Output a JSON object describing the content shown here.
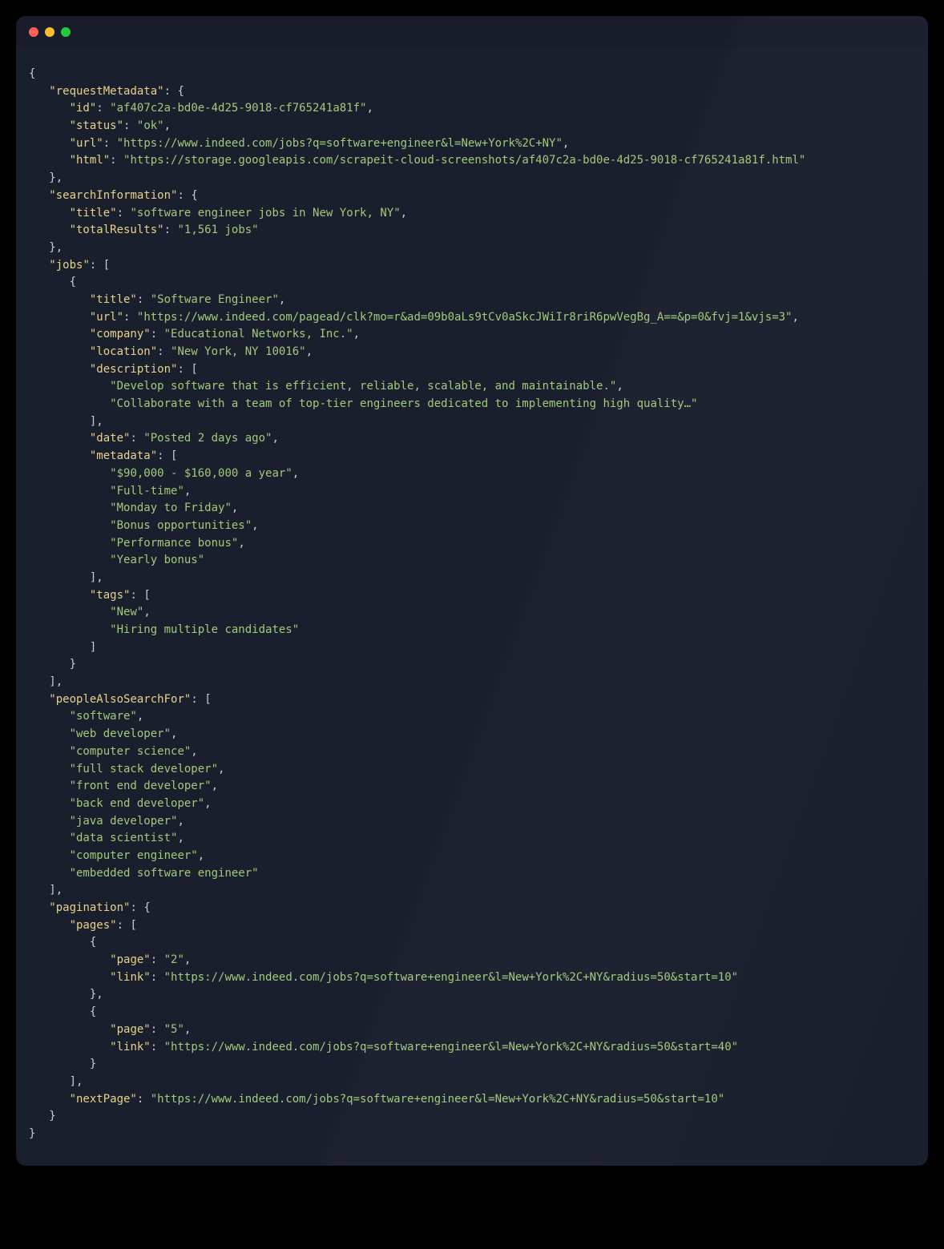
{
  "json": {
    "requestMetadata": {
      "id": "af407c2a-bd0e-4d25-9018-cf765241a81f",
      "status": "ok",
      "url": "https://www.indeed.com/jobs?q=software+engineer&l=New+York%2C+NY",
      "html": "https://storage.googleapis.com/scrapeit-cloud-screenshots/af407c2a-bd0e-4d25-9018-cf765241a81f.html"
    },
    "searchInformation": {
      "title": "software engineer jobs in New York, NY",
      "totalResults": "1,561 jobs"
    },
    "jobs": [
      {
        "title": "Software Engineer",
        "url": "https://www.indeed.com/pagead/clk?mo=r&ad=09b0aLs9tCv0aSkcJWiIr8riR6pwVegBg_A==&p=0&fvj=1&vjs=3",
        "company": "Educational Networks, Inc.",
        "location": "New York, NY 10016",
        "description": [
          "Develop software that is efficient, reliable, scalable, and maintainable.",
          "Collaborate with a team of top-tier engineers dedicated to implementing high quality…"
        ],
        "date": "Posted 2 days ago",
        "metadata": [
          "$90,000 - $160,000 a year",
          "Full-time",
          "Monday to Friday",
          "Bonus opportunities",
          "Performance bonus",
          "Yearly bonus"
        ],
        "tags": [
          "New",
          "Hiring multiple candidates"
        ]
      }
    ],
    "peopleAlsoSearchFor": [
      "software",
      "web developer",
      "computer science",
      "full stack developer",
      "front end developer",
      "back end developer",
      "java developer",
      "data scientist",
      "computer engineer",
      "embedded software engineer"
    ],
    "pagination": {
      "pages": [
        {
          "page": "2",
          "link": "https://www.indeed.com/jobs?q=software+engineer&l=New+York%2C+NY&radius=50&start=10"
        },
        {
          "page": "5",
          "link": "https://www.indeed.com/jobs?q=software+engineer&l=New+York%2C+NY&radius=50&start=40"
        }
      ],
      "nextPage": "https://www.indeed.com/jobs?q=software+engineer&l=New+York%2C+NY&radius=50&start=10"
    }
  }
}
